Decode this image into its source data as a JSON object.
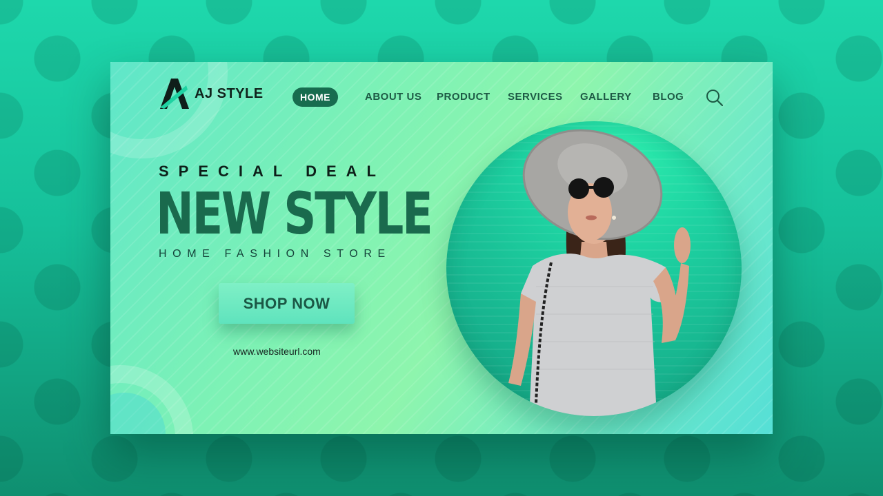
{
  "brand": {
    "name": "AJ STYLE"
  },
  "nav": {
    "items": [
      {
        "label": "HOME",
        "active": true
      },
      {
        "label": "ABOUT US",
        "active": false
      },
      {
        "label": "PRODUCT",
        "active": false
      },
      {
        "label": "SERVICES",
        "active": false
      },
      {
        "label": "GALLERY",
        "active": false
      },
      {
        "label": "BLOG",
        "active": false
      }
    ],
    "search_icon": "search-icon"
  },
  "hero": {
    "kicker": "SPECIAL DEAL",
    "headline": "NEW STYLE",
    "subline": "HOME FASHION STORE",
    "cta_label": "SHOP NOW",
    "url": "www.websiteurl.com"
  },
  "colors": {
    "accent": "#176c4f",
    "headline": "#1a6a4d",
    "background": "#1ed8ac"
  }
}
